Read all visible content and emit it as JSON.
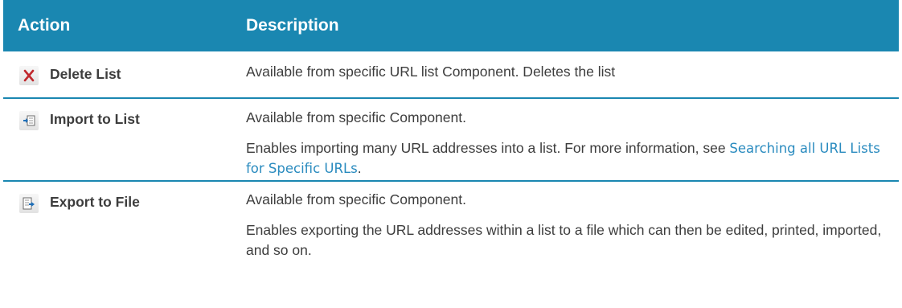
{
  "header": {
    "action": "Action",
    "description": "Description"
  },
  "rows": [
    {
      "icon": "delete-x-icon",
      "action": "Delete List",
      "paragraphs": [
        "Available from specific URL list Component. Deletes the list"
      ]
    },
    {
      "icon": "import-icon",
      "action": "Import to List",
      "paragraphs": [
        "Available from specific Component."
      ],
      "para2_text": "Enables importing many URL addresses into a list. For more information, see ",
      "para2_link": "Searching all URL Lists for Specific URLs",
      "para2_end": "."
    },
    {
      "icon": "export-icon",
      "action": "Export to File",
      "paragraphs": [
        "Available from specific Component.",
        "Enables exporting the URL addresses within a list to a file which can then be edited, printed, imported, and so on."
      ]
    }
  ],
  "colors": {
    "header_bg": "#1a87b1",
    "link": "#2a8bbf",
    "text": "#3d3d3d"
  }
}
